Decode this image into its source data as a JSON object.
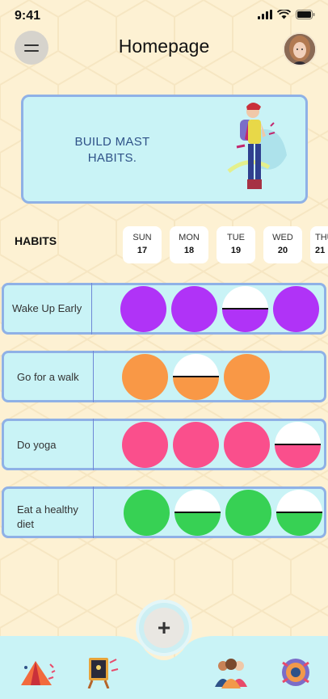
{
  "status_bar": {
    "time": "9:41"
  },
  "header": {
    "title": "Homepage"
  },
  "banner": {
    "text": "BUILD MAST HABITS."
  },
  "habits_label": "HABITS",
  "days": [
    {
      "name": "SUN",
      "num": "17"
    },
    {
      "name": "MON",
      "num": "18"
    },
    {
      "name": "TUE",
      "num": "19"
    },
    {
      "name": "WED",
      "num": "20"
    },
    {
      "name": "THU",
      "num": "21"
    }
  ],
  "habits": [
    {
      "name": "Wake Up Early",
      "color": "#b033f7",
      "marks": [
        "done",
        "done",
        "half",
        "done"
      ]
    },
    {
      "name": "Go for a walk",
      "color": "#f99846",
      "marks": [
        "done",
        "half",
        "done"
      ]
    },
    {
      "name": "Do yoga",
      "color": "#fa4f8c",
      "marks": [
        "done",
        "done",
        "done",
        "half"
      ]
    },
    {
      "name": "Eat a healthy diet",
      "color": "#37d154",
      "marks": [
        "done",
        "half",
        "done",
        "half"
      ]
    }
  ],
  "nav_icons": [
    "camping-tent-icon",
    "easel-board-icon",
    "people-group-icon",
    "gear-cog-icon"
  ],
  "add_label": "+",
  "colors": {
    "background": "#fdf1d3",
    "card": "#c9f3f6",
    "card_border": "#8fb1e6",
    "bottom_bar": "#c9f3f6"
  }
}
